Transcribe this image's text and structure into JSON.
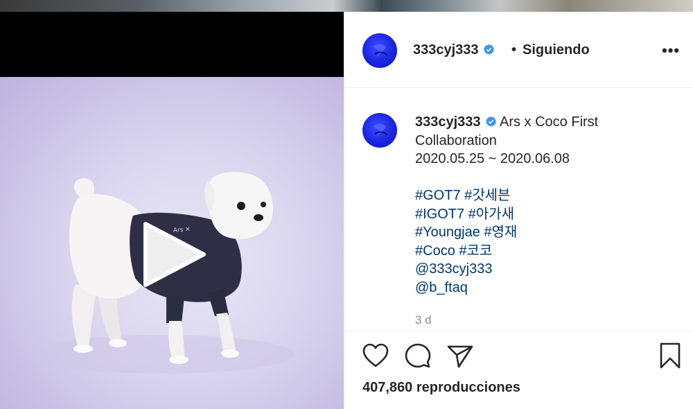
{
  "post": {
    "username": "333cyj333",
    "separator": "•",
    "follow_status": "Siguiendo",
    "more_label": "•••",
    "caption_title_1": "Ars x Coco First",
    "caption_title_2": "Collaboration",
    "date_range": "2020.05.25 ~ 2020.06.08",
    "hashtag_lines": [
      "#GOT7 #갓세븐",
      "#IGOT7 #아가새",
      "#Youngjae #영재",
      "#Coco #코코",
      "@333cyj333",
      "@b_ftaq"
    ],
    "time_ago": "3 d",
    "views": "407,860 reproducciones"
  },
  "colors": {
    "verified": "#3897f0",
    "avatar": "#1a24e0",
    "link": "#00376b",
    "muted": "#8e8e8e"
  },
  "icons": [
    "heart-icon",
    "comment-icon",
    "share-icon",
    "bookmark-icon",
    "play-icon",
    "more-icon",
    "verified-icon"
  ]
}
